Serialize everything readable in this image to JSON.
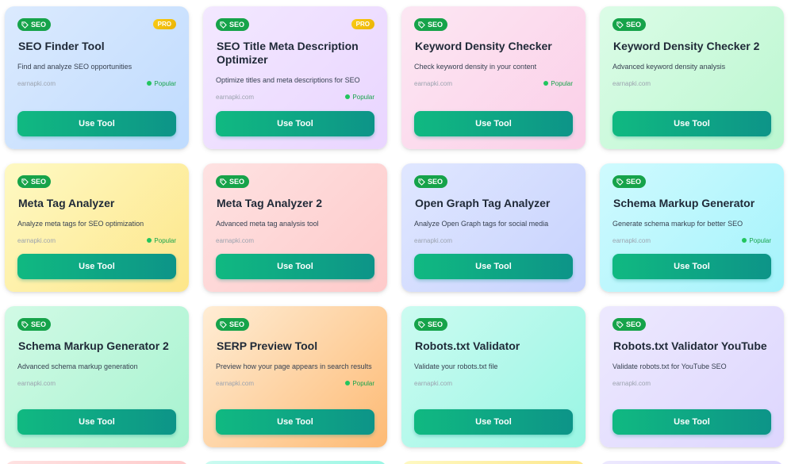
{
  "cards": [
    {
      "badge": "SEO",
      "pro": "PRO",
      "title": "SEO Finder Tool",
      "desc": "Find and analyze SEO opportunities",
      "site": "earnapki.com",
      "popular": "Popular",
      "button": "Use Tool"
    },
    {
      "badge": "SEO",
      "pro": "PRO",
      "title": "SEO Title Meta Description Optimizer",
      "desc": "Optimize titles and meta descriptions for SEO",
      "site": "earnapki.com",
      "popular": "Popular",
      "button": "Use Tool"
    },
    {
      "badge": "SEO",
      "title": "Keyword Density Checker",
      "desc": "Check keyword density in your content",
      "site": "earnapki.com",
      "popular": "Popular",
      "button": "Use Tool"
    },
    {
      "badge": "SEO",
      "title": "Keyword Density Checker 2",
      "desc": "Advanced keyword density analysis",
      "site": "earnapki.com",
      "button": "Use Tool"
    },
    {
      "badge": "SEO",
      "title": "Meta Tag Analyzer",
      "desc": "Analyze meta tags for SEO optimization",
      "site": "earnapki.com",
      "popular": "Popular",
      "button": "Use Tool"
    },
    {
      "badge": "SEO",
      "title": "Meta Tag Analyzer 2",
      "desc": "Advanced meta tag analysis tool",
      "site": "earnapki.com",
      "button": "Use Tool"
    },
    {
      "badge": "SEO",
      "title": "Open Graph Tag Analyzer",
      "desc": "Analyze Open Graph tags for social media",
      "site": "earnapki.com",
      "button": "Use Tool"
    },
    {
      "badge": "SEO",
      "title": "Schema Markup Generator",
      "desc": "Generate schema markup for better SEO",
      "site": "earnapki.com",
      "popular": "Popular",
      "button": "Use Tool"
    },
    {
      "badge": "SEO",
      "title": "Schema Markup Generator 2",
      "desc": "Advanced schema markup generation",
      "site": "earnapki.com",
      "button": "Use Tool"
    },
    {
      "badge": "SEO",
      "title": "SERP Preview Tool",
      "desc": "Preview how your page appears in search results",
      "site": "earnapki.com",
      "popular": "Popular",
      "button": "Use Tool"
    },
    {
      "badge": "SEO",
      "title": "Robots.txt Validator",
      "desc": "Validate your robots.txt file",
      "site": "earnapki.com",
      "button": "Use Tool"
    },
    {
      "badge": "SEO",
      "title": "Robots.txt Validator YouTube",
      "desc": "Validate robots.txt for YouTube SEO",
      "site": "earnapki.com",
      "button": "Use Tool"
    }
  ],
  "colors": {
    "badge": "#16a34a",
    "button_start": "#10b981",
    "button_end": "#0d9488",
    "pro": "#eab308"
  }
}
